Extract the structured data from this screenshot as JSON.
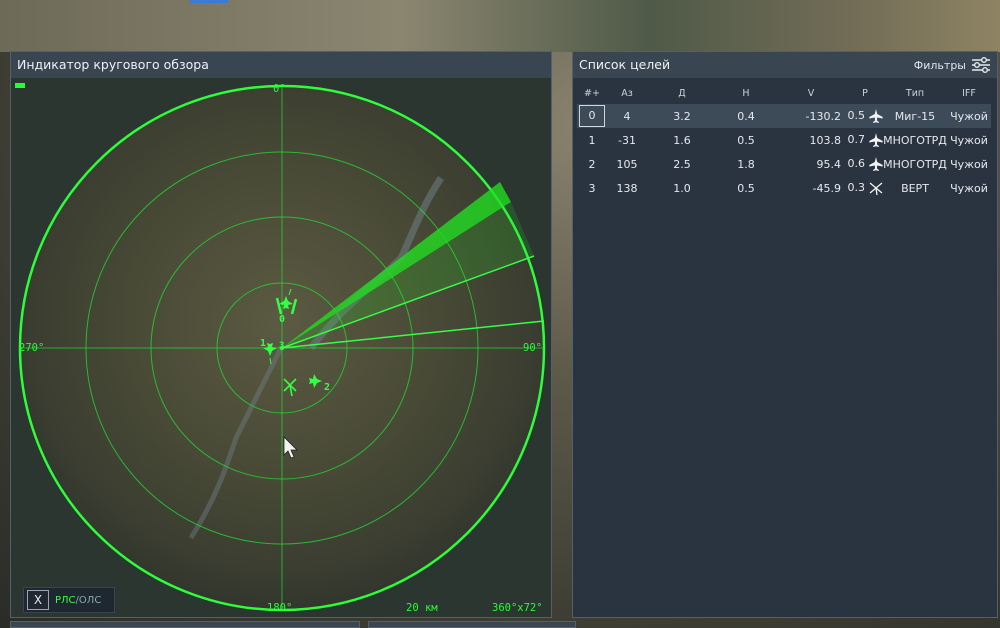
{
  "radar": {
    "title": "Индикатор кругового обзора",
    "north": "0°",
    "east": "90°",
    "south": "180°",
    "west": "270°",
    "range": "20 км",
    "scan": "360°x72°",
    "mode_close": "X",
    "mode_rls": "РЛС",
    "mode_sep": "/",
    "mode_ols": "ОЛС",
    "target_labels": [
      "0",
      "1",
      "2",
      "3"
    ],
    "colors": {
      "scope": "#22ff33",
      "beam": "#22dd22"
    }
  },
  "targets": {
    "title": "Список целей",
    "filters_label": "Фильтры",
    "columns": [
      "#+",
      "Аз",
      "Д",
      "Н",
      "V",
      "Р",
      "Тип",
      "IFF"
    ],
    "rows": [
      {
        "idx": "0",
        "az": "4",
        "d": "3.2",
        "h": "0.4",
        "v": "-130.2",
        "p": "0.5",
        "icon": "jet-icon",
        "type": "Миг-15",
        "iff": "Чужой"
      },
      {
        "idx": "1",
        "az": "-31",
        "d": "1.6",
        "h": "0.5",
        "v": "103.8",
        "p": "0.7",
        "icon": "jet-icon",
        "type": "МНОГОТРД",
        "iff": "Чужой"
      },
      {
        "idx": "2",
        "az": "105",
        "d": "2.5",
        "h": "1.8",
        "v": "95.4",
        "p": "0.6",
        "icon": "jet-icon",
        "type": "МНОГОТРД",
        "iff": "Чужой"
      },
      {
        "idx": "3",
        "az": "138",
        "d": "1.0",
        "h": "0.5",
        "v": "-45.9",
        "p": "0.3",
        "icon": "helicopter-icon",
        "type": "ВЕРТ",
        "iff": "Чужой"
      }
    ]
  }
}
